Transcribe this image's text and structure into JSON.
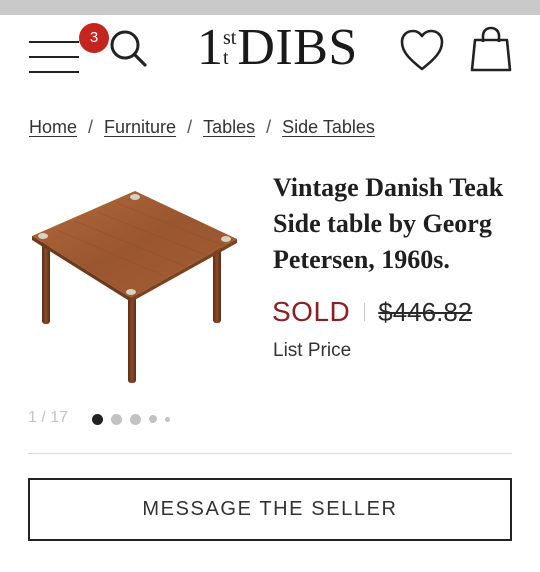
{
  "header": {
    "cart_count": "3",
    "logo": {
      "numeral": "1",
      "super": "st",
      "sub": "t",
      "name": "DIBS"
    },
    "icons": {
      "menu": "hamburger-menu-icon",
      "search": "search-icon",
      "favorites": "heart-icon",
      "bag": "shopping-bag-icon"
    }
  },
  "breadcrumb": {
    "items": [
      {
        "label": "Home"
      },
      {
        "label": "Furniture"
      },
      {
        "label": "Tables"
      },
      {
        "label": "Side Tables"
      }
    ],
    "separator": "/"
  },
  "product": {
    "title": "Vintage Danish Teak Side table by Georg Petersen, 1960s.",
    "status": "SOLD",
    "price": "$446.82",
    "price_label": "List Price",
    "image_alt": "teak side table",
    "colors": {
      "sold": "#8c1f24",
      "badge": "#c4261f"
    }
  },
  "gallery": {
    "counter": "1 / 17",
    "current": 1,
    "total": 17,
    "visible_dots": 5
  },
  "actions": {
    "message_button": "MESSAGE THE SELLER"
  }
}
